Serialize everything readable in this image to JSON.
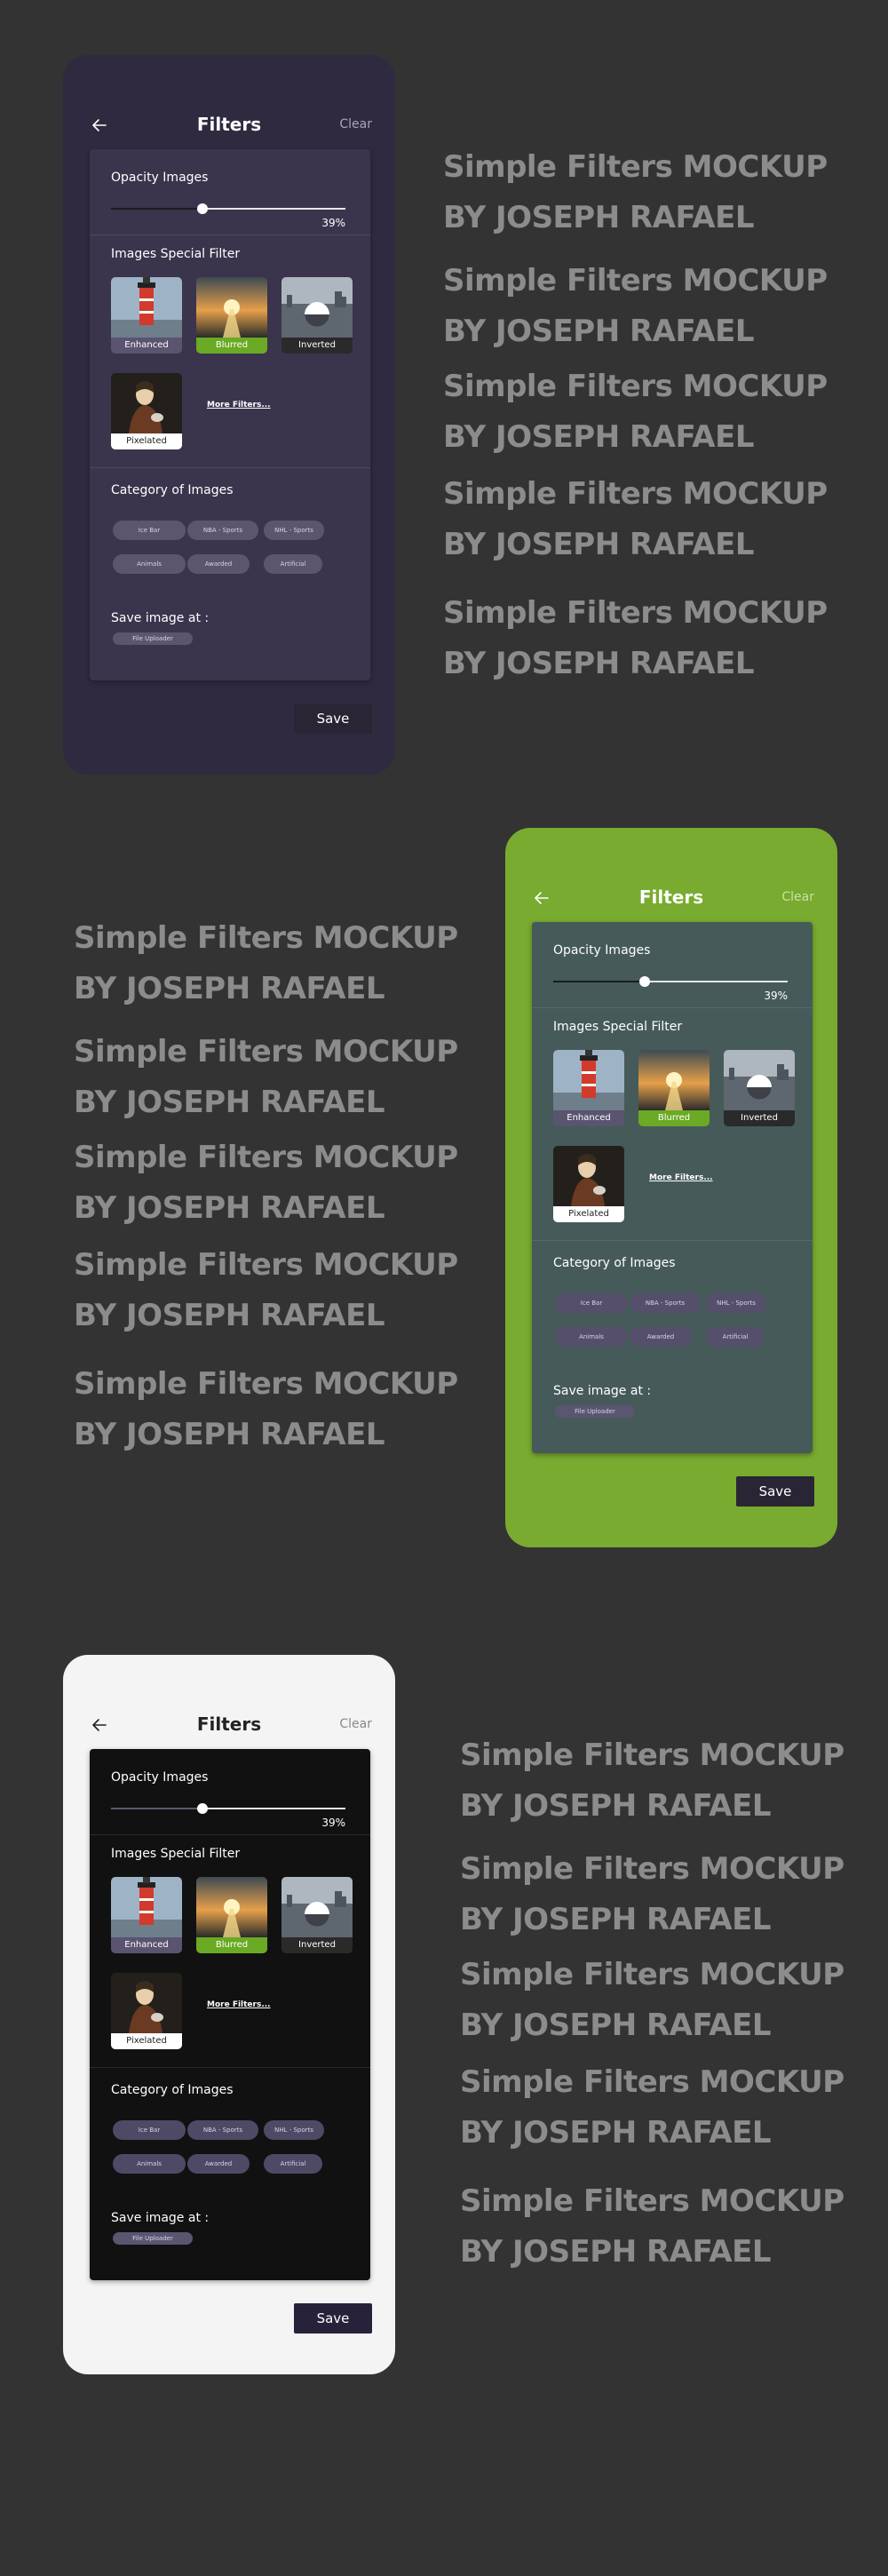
{
  "screen": {
    "title": "Filters",
    "clear_label": "Clear",
    "opacity_title": "Opacity Images",
    "opacity_value_label": "39%",
    "opacity_level": 0.39,
    "filters_title": "Images Special Filter",
    "filters": [
      {
        "label": "Enhanced",
        "image": "lighthouse",
        "state": "default"
      },
      {
        "label": "Blurred",
        "image": "sunset-road",
        "state": "selected"
      },
      {
        "label": "Inverted",
        "image": "city-sphere",
        "state": "dark"
      },
      {
        "label": "Pixelated",
        "image": "portrait-painting",
        "state": "light"
      }
    ],
    "more_filters_label": "More Filters...",
    "category_title": "Category of Images",
    "categories": [
      "Ice Bar",
      "NBA - Sports",
      "NHL - Sports",
      "Animals",
      "Awarded",
      "Artificial"
    ],
    "save_at_title": "Save image at :",
    "save_at_value": "File Uploader",
    "save_label": "Save"
  },
  "mockup_text": {
    "line1": "Simple Filters MOCKUP",
    "line2": "BY JOSEPH RAFAEL"
  },
  "themes": [
    {
      "name": "purple",
      "background": "#2f2a40",
      "card": "#3b344d",
      "title_color": "#ffffff"
    },
    {
      "name": "green",
      "background": "#78ab2f",
      "card": "#465a5a",
      "title_color": "#ffffff"
    },
    {
      "name": "light",
      "background": "#f4f4f4",
      "card": "#111111",
      "title_color": "#222222"
    }
  ],
  "colors": {
    "page_background": "#333333",
    "mockup_text": "#8c8c8c",
    "selected_filter": "#6aaa24"
  }
}
